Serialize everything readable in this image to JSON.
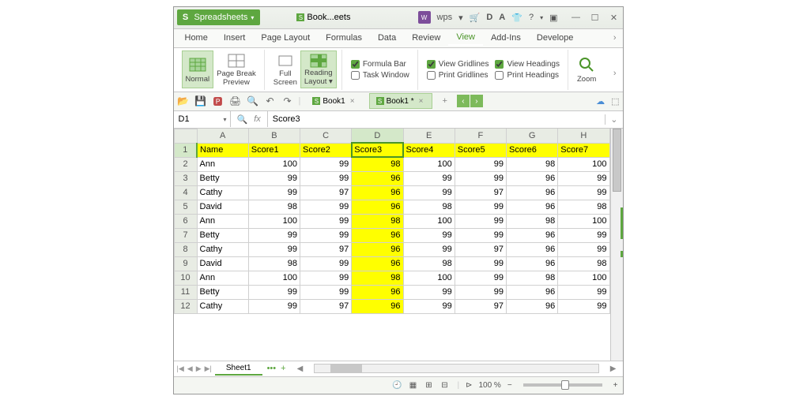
{
  "titlebar": {
    "brand": "Spreadsheets",
    "doc_tab": "Book...eets",
    "wps_label": "wps"
  },
  "menubar": {
    "items": [
      "Home",
      "Insert",
      "Page Layout",
      "Formulas",
      "Data",
      "Review",
      "View",
      "Add-Ins",
      "Develope"
    ],
    "active_index": 6
  },
  "ribbon": {
    "normal": "Normal",
    "page_break": "Page Break\nPreview",
    "full_screen": "Full\nScreen",
    "reading_layout": "Reading\nLayout ▾",
    "zoom": "Zoom",
    "checks_col1": [
      {
        "label": "Formula Bar",
        "checked": true
      },
      {
        "label": "Task Window",
        "checked": false
      }
    ],
    "checks_col2": [
      {
        "label": "View Gridlines",
        "checked": true
      },
      {
        "label": "Print Gridlines",
        "checked": false
      }
    ],
    "checks_col3": [
      {
        "label": "View Headings",
        "checked": true
      },
      {
        "label": "Print Headings",
        "checked": false
      }
    ]
  },
  "qat": {
    "tab1": "Book1",
    "tab2": "Book1 *"
  },
  "formula_bar": {
    "name_box": "D1",
    "fx": "fx",
    "value": "Score3"
  },
  "grid": {
    "columns": [
      "A",
      "B",
      "C",
      "D",
      "E",
      "F",
      "G",
      "H"
    ],
    "active_col_index": 3,
    "header_row": [
      "Name",
      "Score1",
      "Score2",
      "Score3",
      "Score4",
      "Score5",
      "Score6",
      "Score7"
    ],
    "rows": [
      {
        "n": 2,
        "cells": [
          "Ann",
          100,
          99,
          98,
          100,
          99,
          98,
          100
        ]
      },
      {
        "n": 3,
        "cells": [
          "Betty",
          99,
          99,
          96,
          99,
          99,
          96,
          99
        ]
      },
      {
        "n": 4,
        "cells": [
          "Cathy",
          99,
          97,
          96,
          99,
          97,
          96,
          99
        ]
      },
      {
        "n": 5,
        "cells": [
          "David",
          98,
          99,
          96,
          98,
          99,
          96,
          98
        ]
      },
      {
        "n": 6,
        "cells": [
          "Ann",
          100,
          99,
          98,
          100,
          99,
          98,
          100
        ]
      },
      {
        "n": 7,
        "cells": [
          "Betty",
          99,
          99,
          96,
          99,
          99,
          96,
          99
        ]
      },
      {
        "n": 8,
        "cells": [
          "Cathy",
          99,
          97,
          96,
          99,
          97,
          96,
          99
        ]
      },
      {
        "n": 9,
        "cells": [
          "David",
          98,
          99,
          96,
          98,
          99,
          96,
          98
        ]
      },
      {
        "n": 10,
        "cells": [
          "Ann",
          100,
          99,
          98,
          100,
          99,
          98,
          100
        ]
      },
      {
        "n": 11,
        "cells": [
          "Betty",
          99,
          99,
          96,
          99,
          99,
          96,
          99
        ]
      },
      {
        "n": 12,
        "cells": [
          "Cathy",
          99,
          97,
          96,
          99,
          97,
          96,
          99
        ]
      }
    ]
  },
  "sheet_bar": {
    "sheet1": "Sheet1"
  },
  "status_bar": {
    "zoom": "100 %"
  }
}
